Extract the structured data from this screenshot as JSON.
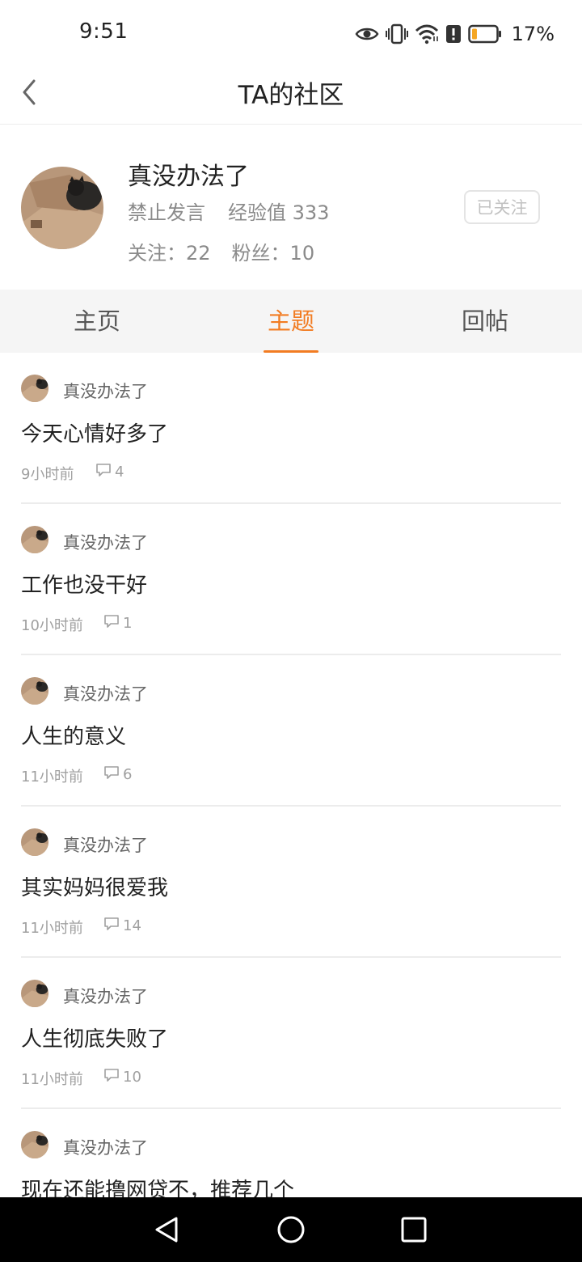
{
  "status_bar": {
    "time": "9:51",
    "battery_percent": "17%",
    "battery_level": 0.17,
    "battery_color": "#f5a623",
    "icons": [
      "eye-icon",
      "vibrate-icon",
      "wifi-icon",
      "alert-icon",
      "battery-icon"
    ]
  },
  "nav": {
    "title": "TA的社区",
    "back_icon": "chevron-left-icon"
  },
  "profile": {
    "name": "真没办法了",
    "status": "禁止发言",
    "experience": "经验值 333",
    "following": "关注：22",
    "followers": "粉丝：10",
    "follow_button": "已关注"
  },
  "tabs": [
    {
      "label": "主页",
      "active": false
    },
    {
      "label": "主题",
      "active": true
    },
    {
      "label": "回帖",
      "active": false
    }
  ],
  "accent_color": "#f27c22",
  "posts": [
    {
      "author": "真没办法了",
      "title": "今天心情好多了",
      "time": "9小时前",
      "comments": "4"
    },
    {
      "author": "真没办法了",
      "title": "工作也没干好",
      "time": "10小时前",
      "comments": "1"
    },
    {
      "author": "真没办法了",
      "title": "人生的意义",
      "time": "11小时前",
      "comments": "6"
    },
    {
      "author": "真没办法了",
      "title": "其实妈妈很爱我",
      "time": "11小时前",
      "comments": "14"
    },
    {
      "author": "真没办法了",
      "title": "人生彻底失败了",
      "time": "11小时前",
      "comments": "10"
    },
    {
      "author": "真没办法了",
      "title": "现在还能撸网贷不，推荐几个",
      "time": "",
      "comments": ""
    }
  ],
  "system_nav": [
    "back-triangle-icon",
    "home-circle-icon",
    "recents-square-icon"
  ]
}
